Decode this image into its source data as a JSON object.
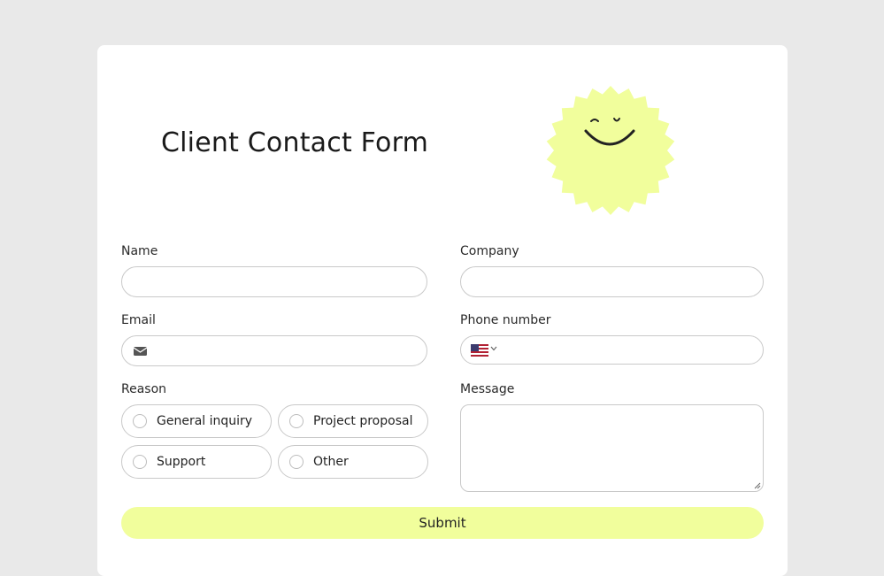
{
  "form": {
    "title": "Client Contact Form",
    "submit_label": "Submit"
  },
  "fields": {
    "name": {
      "label": "Name",
      "value": "",
      "placeholder": ""
    },
    "company": {
      "label": "Company",
      "value": "",
      "placeholder": ""
    },
    "email": {
      "label": "Email",
      "value": "",
      "placeholder": "",
      "icon": "envelope-icon"
    },
    "phone": {
      "label": "Phone number",
      "value": "",
      "country": "US",
      "icon": "us-flag-icon"
    },
    "reason": {
      "label": "Reason",
      "options": [
        "General inquiry",
        "Project proposal",
        "Support",
        "Other"
      ],
      "selected": null
    },
    "message": {
      "label": "Message",
      "value": "",
      "placeholder": ""
    }
  },
  "colors": {
    "accent": "#f1fe9c",
    "background": "#e9e9e9",
    "card": "#ffffff",
    "border": "#c9c9c9"
  },
  "illustration": {
    "icon": "smiling-sun-icon"
  }
}
